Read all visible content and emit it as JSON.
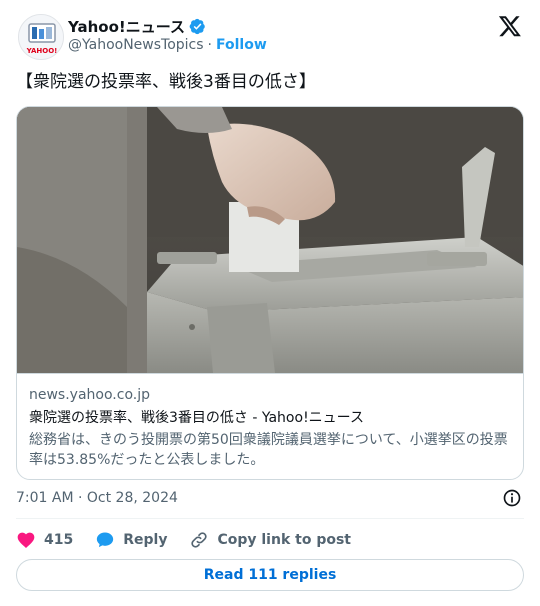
{
  "author": {
    "name": "Yahoo!ニュース",
    "handle": "@YahooNewsTopics",
    "separator": "·",
    "follow_label": "Follow",
    "avatar_text": "YAHOO!"
  },
  "tweet": {
    "text": "【衆院選の投票率、戦後3番目の低さ】"
  },
  "link_card": {
    "domain": "news.yahoo.co.jp",
    "title": "衆院選の投票率、戦後3番目の低さ - Yahoo!ニュース",
    "description": "総務省は、きのう投開票の第50回衆議院議員選挙について、小選挙区の投票率は53.85%だったと公表しました。"
  },
  "meta": {
    "timestamp": "7:01 AM · Oct 28, 2024"
  },
  "actions": {
    "like_count": "415",
    "reply_label": "Reply",
    "copy_label": "Copy link to post"
  },
  "read_replies_label": "Read 111 replies",
  "colors": {
    "accent": "#1d9bf0",
    "like": "#f91880",
    "text": "#0f1419",
    "muted": "#536471",
    "border": "#cfd9de"
  },
  "icons": {
    "brand": "x-logo-icon",
    "verified": "verified-badge-icon",
    "info": "info-icon",
    "like": "heart-icon",
    "reply": "speech-bubble-icon",
    "copy": "link-icon"
  }
}
